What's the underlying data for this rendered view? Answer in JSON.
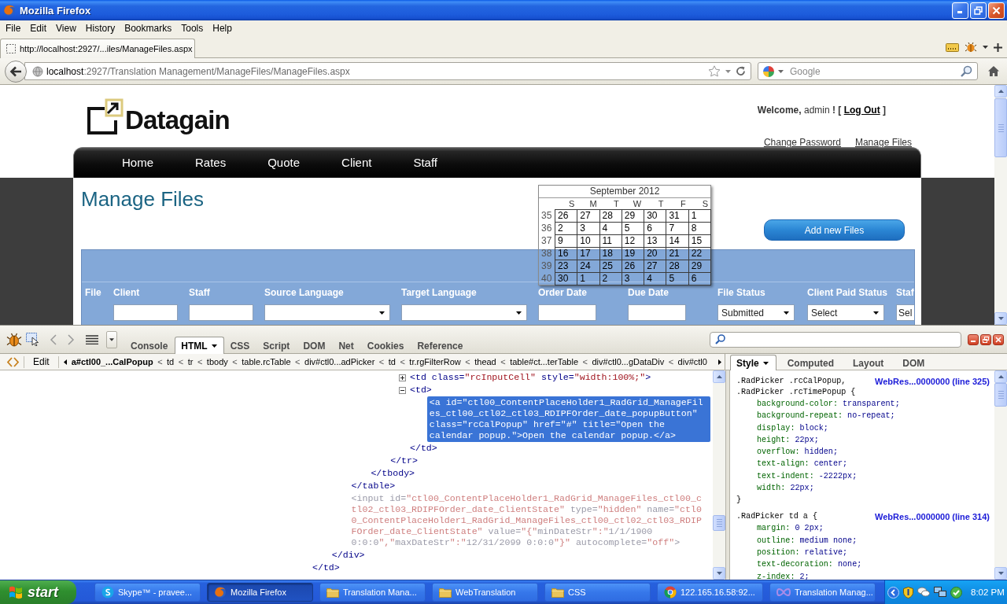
{
  "window": {
    "title": "Mozilla Firefox"
  },
  "menu": [
    "File",
    "Edit",
    "View",
    "History",
    "Bookmarks",
    "Tools",
    "Help"
  ],
  "tabs": [
    {
      "label": "http://localhost:2927/...iles/ManageFiles.aspx",
      "selected": true
    }
  ],
  "address": {
    "host": "localhost",
    "path": ":2927/Translation Management/ManageFiles/ManageFiles.aspx"
  },
  "search": {
    "placeholder": "Google"
  },
  "page": {
    "logo": "Datagain",
    "welcome": {
      "text": "**Welcome,** admin **! [**",
      "logout": "Log Out",
      "close": "]"
    },
    "links": [
      "Change Password",
      "Manage Files"
    ],
    "nav": [
      "Home",
      "Rates",
      "Quote",
      "Client",
      "Staff"
    ],
    "heading": "Manage Files",
    "add_button": "Add new Files",
    "grid": {
      "columns": [
        {
          "label": "File"
        },
        {
          "label": "Client",
          "filter": {
            "kind": "text"
          }
        },
        {
          "label": "Staff",
          "filter": {
            "kind": "text"
          }
        },
        {
          "label": "Source Language",
          "filter": {
            "kind": "select"
          }
        },
        {
          "label": "Target Language",
          "filter": {
            "kind": "select"
          }
        },
        {
          "label": "Order Date",
          "filter": {
            "kind": "text"
          }
        },
        {
          "label": "Due Date",
          "filter": {
            "kind": "text"
          }
        },
        {
          "label": "File Status",
          "filter": {
            "kind": "select",
            "value": "Submitted"
          }
        },
        {
          "label": "Client Paid Status",
          "filter": {
            "kind": "select",
            "value": "Select"
          }
        },
        {
          "label": "Staf",
          "filter": {
            "kind": "clipped",
            "value": "Sel"
          }
        }
      ]
    },
    "calendar": {
      "title": "September 2012",
      "weekdays": [
        "S",
        "M",
        "T",
        "W",
        "T",
        "F",
        "S"
      ],
      "weeks": [
        {
          "number": "35",
          "days": [
            "26",
            "27",
            "28",
            "29",
            "30",
            "31",
            "1"
          ]
        },
        {
          "number": "36",
          "days": [
            "2",
            "3",
            "4",
            "5",
            "6",
            "7",
            "8"
          ]
        },
        {
          "number": "37",
          "days": [
            "9",
            "10",
            "11",
            "12",
            "13",
            "14",
            "15"
          ]
        },
        {
          "number": "38",
          "days": [
            "16",
            "17",
            "18",
            "19",
            "20",
            "21",
            "22"
          ]
        },
        {
          "number": "39",
          "days": [
            "23",
            "24",
            "25",
            "26",
            "27",
            "28",
            "29"
          ]
        },
        {
          "number": "40",
          "days": [
            "30",
            "1",
            "2",
            "3",
            "4",
            "5",
            "6"
          ]
        }
      ]
    }
  },
  "firebug": {
    "tabs": [
      {
        "label": "Console",
        "selected": false
      },
      {
        "label": "HTML",
        "selected": true
      },
      {
        "label": "CSS",
        "selected": false
      },
      {
        "label": "Script",
        "selected": false
      },
      {
        "label": "DOM",
        "selected": false
      },
      {
        "label": "Net",
        "selected": false
      },
      {
        "label": "Cookies",
        "selected": false
      },
      {
        "label": "Reference",
        "selected": false
      }
    ],
    "edit": "Edit",
    "breadcrumbs": [
      {
        "label": "a#ctl00_...CalPopup",
        "selected": true
      },
      {
        "separator": "<",
        "label": "td",
        "selected": false
      },
      {
        "separator": "<",
        "label": "tr",
        "selected": false
      },
      {
        "separator": "<",
        "label": "tbody",
        "selected": false
      },
      {
        "separator": "<",
        "label": "table.rcTable",
        "selected": false
      },
      {
        "separator": "<",
        "label": "div#ctl0...adPicker",
        "selected": false
      },
      {
        "separator": "<",
        "label": "td",
        "selected": false
      },
      {
        "separator": "<",
        "label": "tr.rgFilterRow",
        "selected": false
      },
      {
        "separator": "<",
        "label": "thead",
        "selected": false
      },
      {
        "separator": "<",
        "label": "table#ct...terTable",
        "selected": false
      },
      {
        "separator": "<",
        "label": "div#ctl0...gDataDiv",
        "selected": false
      },
      {
        "separator": "<",
        "label": "div#ctl0",
        "selected": false
      }
    ],
    "side_tabs": [
      {
        "label": "Style",
        "selected": true
      },
      {
        "label": "Computed",
        "selected": false
      },
      {
        "label": "Layout",
        "selected": false
      },
      {
        "label": "DOM",
        "selected": false
      }
    ],
    "html_tree": [
      {
        "close": "</td>",
        "selected": false,
        "children": [
          {
            "close": "</div>",
            "selected": false,
            "children": [
              {
                "close": "</table>",
                "selected": false,
                "children": [
                  {
                    "close": "</tbody>",
                    "selected": false,
                    "children": [
                      {
                        "close": "</tr>",
                        "selected": false,
                        "children": [
                          {
                            "text": "<td class=\"rcInputCell\" style=\"width:100%;\">",
                            "expanded": false,
                            "selected": false,
                            "dimmed": false
                          },
                          {
                            "text": "<td>",
                            "expanded": true,
                            "selected": false,
                            "dimmed": false,
                            "close": "</td>",
                            "children": [
                              {
                                "text": "<a id=\"ctl00_ContentPlaceHolder1_RadGrid_ManageFiles_ctl00_ctl02_ctl03_RDIPFOrder_date_popupButton\" class=\"rcCalPopup\" href=\"#\" title=\"Open the calendar popup.\">Open the calendar popup.</a>",
                                "selected": true,
                                "dimmed": false
                              }
                            ]
                          }
                        ]
                      }
                    ]
                  }
                ]
              },
              {
                "text": "<input id=\"ctl00_ContentPlaceHolder1_RadGrid_ManageFiles_ctl00_ctl02_ctl03_RDIPFOrder_date_ClientState\" type=\"hidden\" name=\"ctl00_ContentPlaceHolder1_RadGrid_ManageFiles_ctl00_ctl02_ctl03_RDIPFOrder_date_ClientState\" value=\"{\"minDateStr\":\"1/1/1900 0:0:0\",\"maxDateStr\":\"12/31/2099 0:0:0\"}\" autocomplete=\"off\">",
                "selected": false,
                "dimmed": true
              }
            ]
          }
        ]
      }
    ],
    "style_rules": [
      {
        "selectors": [
          ".RadPicker .rcCalPopup,",
          ".RadPicker .rcTimePopup {"
        ],
        "source": "WebRes...0000000 (line 325)",
        "declarations": [
          "background-color: transparent;",
          "background-repeat: no-repeat;",
          "display: block;",
          "height: 22px;",
          "overflow: hidden;",
          "text-align: center;",
          "text-indent: -2222px;",
          "width: 22px;"
        ],
        "close": "}"
      },
      {
        "selectors": [
          ".RadPicker td a {"
        ],
        "source": "WebRes...0000000 (line 314)",
        "declarations": [
          "margin: 0 2px;",
          "outline: medium none;",
          "position: relative;",
          "text-decoration: none;",
          "z-index: 2;"
        ]
      }
    ]
  },
  "taskbar": {
    "start": "start",
    "tasks": [
      {
        "label": "Skype™ - pravee...",
        "kind": "messenger",
        "selected": false
      },
      {
        "label": "Mozilla Firefox",
        "kind": "firefox",
        "selected": true
      },
      {
        "label": "Translation Mana...",
        "kind": "folder",
        "selected": false
      },
      {
        "label": "WebTranslation",
        "kind": "folder",
        "selected": false
      },
      {
        "label": "CSS",
        "kind": "folder",
        "selected": false
      },
      {
        "label": "122.165.16.58:92...",
        "kind": "chrome",
        "selected": false
      },
      {
        "label": "Translation Manag...",
        "kind": "studio",
        "selected": false
      }
    ],
    "clock": "8:02 PM"
  }
}
